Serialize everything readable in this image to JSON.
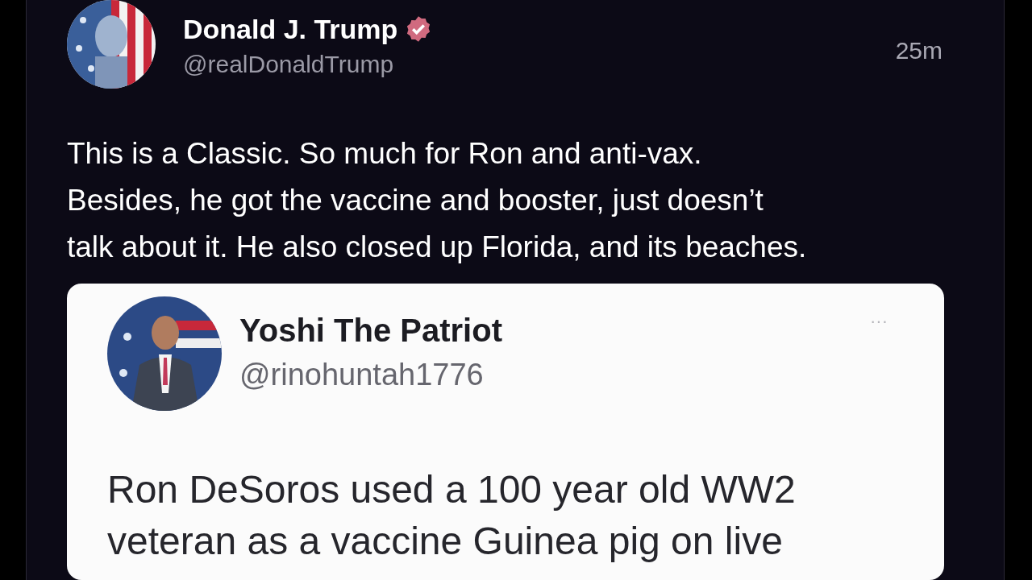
{
  "post": {
    "author": "Donald J. Trump",
    "verified": true,
    "handle": "@realDonaldTrump",
    "time": "25m",
    "body_lines": [
      "This is a Classic. So much for Ron and anti-vax.",
      "Besides, he got the vaccine and booster, just doesn’t",
      "talk about it. He also closed up Florida, and its beaches."
    ]
  },
  "quoted_post": {
    "author": "Yoshi The Patriot",
    "handle": "@rinohuntah1776",
    "more": "···",
    "body_lines": [
      "Ron DeSoros used a 100 year old WW2",
      "veteran as a vaccine Guinea pig on live"
    ]
  }
}
